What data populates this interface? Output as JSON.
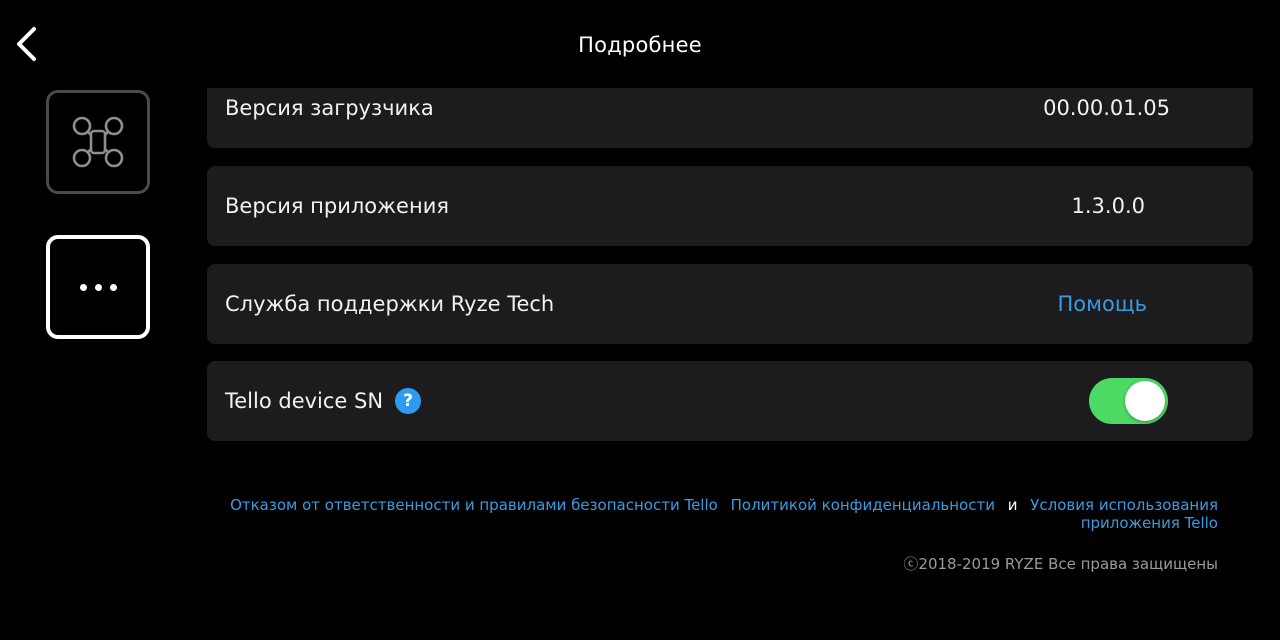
{
  "header": {
    "title": "Подробнее",
    "back_icon": "chevron-left-icon"
  },
  "sidebar": {
    "items": [
      {
        "icon": "drone-icon",
        "selected": false
      },
      {
        "icon": "more-dots-icon",
        "selected": true
      }
    ]
  },
  "rows": [
    {
      "label": "Версия загрузчика",
      "value": "00.00.01.05"
    },
    {
      "label": "Версия приложения",
      "value": "1.3.0.0"
    },
    {
      "label": "Служба поддержки Ryze Tech",
      "link": "Помощь"
    },
    {
      "label": "Tello device SN",
      "help": "?",
      "toggle_on": true
    }
  ],
  "footer": {
    "disclaimer_link": "Отказом от ответственности и правилами безопасности Tello",
    "privacy_link": "Политикой конфиденциальности",
    "and_text": "и",
    "terms_link": "Условия использования приложения Tello",
    "copyright": "ⓒ2018-2019 RYZE Все права защищены"
  },
  "colors": {
    "background": "#000000",
    "row_background": "#1c1c1e",
    "link": "#3a9be0",
    "toggle_on": "#4cd964",
    "help_badge": "#2d9cf0"
  }
}
